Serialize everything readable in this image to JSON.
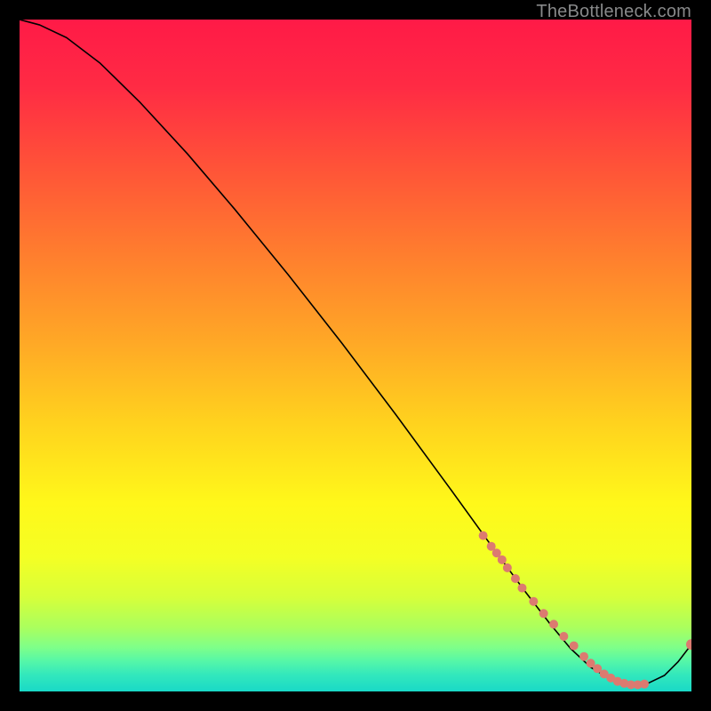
{
  "watermark": "TheBottleneck.com",
  "chart_data": {
    "type": "line",
    "title": "",
    "xlabel": "",
    "ylabel": "",
    "xlim": [
      0,
      100
    ],
    "ylim": [
      0,
      100
    ],
    "legend": false,
    "grid": false,
    "gradient_stops": [
      {
        "offset": 0.0,
        "color": "#ff1a47"
      },
      {
        "offset": 0.1,
        "color": "#ff2b44"
      },
      {
        "offset": 0.22,
        "color": "#ff5338"
      },
      {
        "offset": 0.35,
        "color": "#ff7e2e"
      },
      {
        "offset": 0.48,
        "color": "#ffa826"
      },
      {
        "offset": 0.6,
        "color": "#ffd21e"
      },
      {
        "offset": 0.72,
        "color": "#fff81a"
      },
      {
        "offset": 0.8,
        "color": "#f4ff24"
      },
      {
        "offset": 0.86,
        "color": "#d6ff3a"
      },
      {
        "offset": 0.905,
        "color": "#aaff5e"
      },
      {
        "offset": 0.935,
        "color": "#7dff8a"
      },
      {
        "offset": 0.955,
        "color": "#55f7a8"
      },
      {
        "offset": 0.975,
        "color": "#33e8bc"
      },
      {
        "offset": 1.0,
        "color": "#19d9c7"
      }
    ],
    "curve": {
      "x": [
        0,
        3,
        7,
        12,
        18,
        25,
        32,
        40,
        48,
        56,
        64,
        70,
        75,
        79,
        82,
        85,
        88,
        91,
        93.5,
        96,
        98,
        100
      ],
      "y": [
        100,
        99.2,
        97.3,
        93.5,
        87.6,
        80.0,
        71.8,
        62.0,
        51.8,
        41.2,
        30.3,
        22.0,
        15.2,
        10.0,
        6.4,
        3.6,
        1.8,
        1.0,
        1.2,
        2.4,
        4.4,
        7.0
      ],
      "stroke": "#000000",
      "width": 1.6
    },
    "points": {
      "marker_color": "#dc7a70",
      "marker_radius_small": 5.0,
      "marker_radius_large": 6.0,
      "x": [
        69.0,
        70.2,
        71.0,
        71.8,
        72.6,
        73.8,
        74.8,
        76.5,
        78.0,
        79.5,
        81.0,
        82.5,
        84.0,
        85.0,
        86.0,
        87.0,
        88.0,
        89.0,
        90.0,
        91.0,
        92.0,
        93.0,
        100.0
      ],
      "y": [
        23.2,
        21.6,
        20.6,
        19.6,
        18.4,
        16.8,
        15.4,
        13.4,
        11.6,
        10.0,
        8.2,
        6.8,
        5.2,
        4.2,
        3.4,
        2.6,
        2.0,
        1.5,
        1.2,
        1.0,
        1.0,
        1.1,
        7.0
      ],
      "large_last": true
    }
  }
}
